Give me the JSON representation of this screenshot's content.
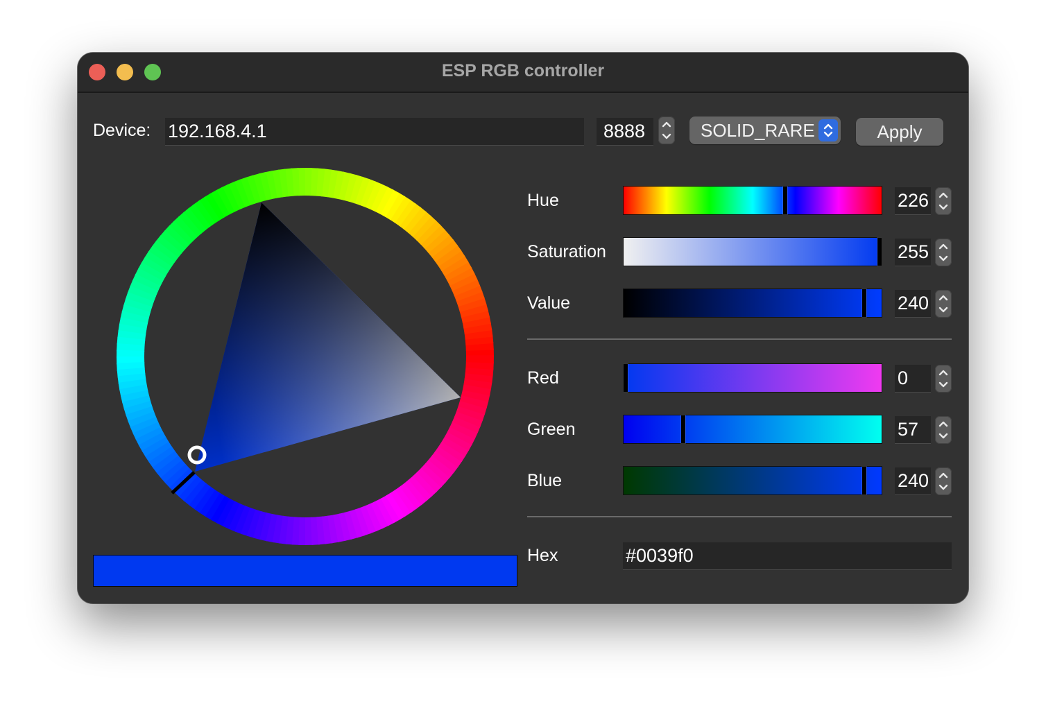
{
  "window": {
    "title": "ESP RGB controller"
  },
  "device": {
    "label": "Device:",
    "address": "192.168.4.1",
    "port": "8888",
    "mode": "SOLID_RARE",
    "apply_label": "Apply"
  },
  "hsv": {
    "hue": {
      "label": "Hue",
      "value": "226"
    },
    "saturation": {
      "label": "Saturation",
      "value": "255"
    },
    "value": {
      "label": "Value",
      "value": "240"
    }
  },
  "rgb": {
    "red": {
      "label": "Red",
      "value": "0"
    },
    "green": {
      "label": "Green",
      "value": "57"
    },
    "blue": {
      "label": "Blue",
      "value": "240"
    }
  },
  "hex": {
    "label": "Hex",
    "value": "#0039f0"
  },
  "colors": {
    "current": "#0039f0",
    "window_bg": "#323232",
    "accent": "#2f6ce0"
  },
  "icons": [
    "close-icon",
    "minimize-icon",
    "maximize-icon",
    "chevron-up-icon",
    "chevron-down-icon",
    "updown-chevron-icon"
  ]
}
